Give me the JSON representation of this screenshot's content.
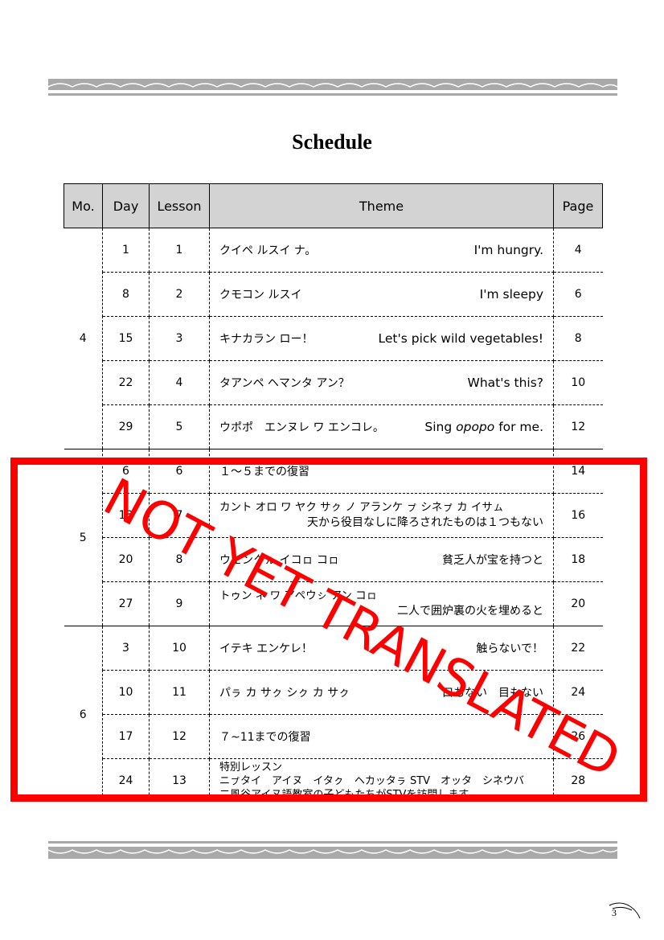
{
  "title": "Schedule",
  "headers": {
    "mo": "Mo.",
    "day": "Day",
    "lesson": "Lesson",
    "theme": "Theme",
    "page": "Page"
  },
  "months": [
    "4",
    "5",
    "6"
  ],
  "rows": [
    {
      "day": "1",
      "lesson": "1",
      "jp": "クイペ ルスイ ナ。",
      "en": "I'm hungry.",
      "page": "4"
    },
    {
      "day": "8",
      "lesson": "2",
      "jp": "クモコン ルスイ",
      "en": "I'm sleepy",
      "page": "6"
    },
    {
      "day": "15",
      "lesson": "3",
      "jp": "キナカラン ロー！",
      "en": "Let's pick wild vegetables!",
      "page": "8"
    },
    {
      "day": "22",
      "lesson": "4",
      "jp": "タアンペ ヘマンタ アン？",
      "en": "What's this?",
      "page": "10"
    },
    {
      "day": "29",
      "lesson": "5",
      "jp": "ウポポ　エンヌレ ワ エンコレ。",
      "en_pre": "Sing ",
      "en_em": "opopo",
      "en_post": " for me.",
      "page": "12"
    },
    {
      "day": "6",
      "lesson": "6",
      "jp": "１～５までの復習",
      "page": "14"
    },
    {
      "day": "13",
      "lesson": "7",
      "l1": "カント オロ ワ ヤク サㇰ ノ アランケ ㇷ゚ シネㇷ゚ カ イサㇺ",
      "l2": "天から役目なしに降ろされたものは１つもない",
      "page": "16"
    },
    {
      "day": "20",
      "lesson": "8",
      "jp": "ウェンクㇽ イコㇿ コㇿ",
      "en": "貧乏人が宝を持つと",
      "page": "18"
    },
    {
      "day": "27",
      "lesson": "9",
      "l1": "トゥン ネ ワ アペウㇱ アン コㇿ",
      "l2": "二人で囲炉裏の火を埋めると",
      "page": "20"
    },
    {
      "day": "3",
      "lesson": "10",
      "jp": "イテキ エンケレ！",
      "en": "触らないで！",
      "page": "22"
    },
    {
      "day": "10",
      "lesson": "11",
      "jp": "パㇻ カ サㇰ シㇰ カ サㇰ",
      "en": "口もない　目もない",
      "page": "24"
    },
    {
      "day": "17",
      "lesson": "12",
      "jp": "７~11までの復習",
      "page": "26"
    },
    {
      "day": "24",
      "lesson": "13",
      "t1": "特別レッスン",
      "t2": "ニㇷ゚タイ　アイヌ　イタㇰ　ヘカッタㇻ STV　オッタ　シネウバ",
      "t3": "二風谷アイヌ語教室の子どもたちがSTVを訪問します",
      "page": "28"
    }
  ],
  "stamp": "NOT YET TRANSLATED",
  "page_number": "3",
  "colors": {
    "stamp": "#ff0000",
    "header_bg": "#d3d3d3",
    "band": "#a9a9a9"
  }
}
